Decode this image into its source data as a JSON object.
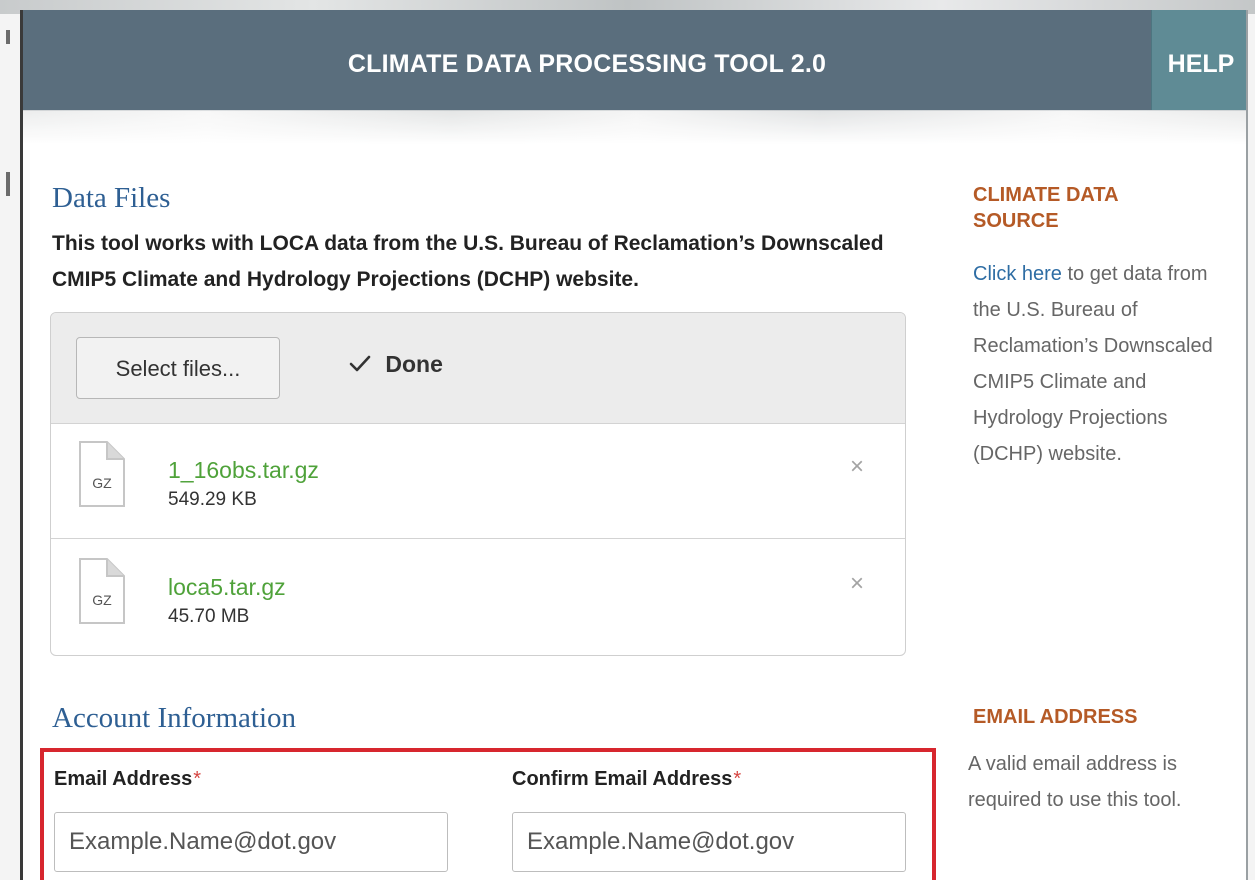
{
  "header": {
    "title": "CLIMATE DATA PROCESSING TOOL 2.0",
    "help_label": "HELP"
  },
  "data_files": {
    "section_title": "Data Files",
    "description": "This tool works with LOCA data from the U.S. Bureau of Reclamation’s Downscaled CMIP5 Climate and Hydrology Projections (DCHP) website.",
    "select_button": "Select files...",
    "status_icon": "check-icon",
    "status_label": "Done",
    "files": [
      {
        "icon_label": "GZ",
        "name": "1_16obs.tar.gz",
        "size": "549.29 KB",
        "remove_icon": "×"
      },
      {
        "icon_label": "GZ",
        "name": "loca5.tar.gz",
        "size": "45.70 MB",
        "remove_icon": "×"
      }
    ]
  },
  "sidebar": {
    "climate_heading": "CLIMATE DATA SOURCE",
    "climate_link": "Click here",
    "climate_text": " to get data from the U.S. Bureau of Reclamation’s Downscaled CMIP5 Climate and Hydrology Projections (DCHP) website.",
    "email_heading": "EMAIL ADDRESS",
    "email_text": "A valid email address is required to use this tool."
  },
  "account": {
    "section_title": "Account Information",
    "required_marker": "*",
    "email_label": "Email Address",
    "email_placeholder": "Example.Name@dot.gov",
    "confirm_label": "Confirm Email Address",
    "confirm_placeholder": "Example.Name@dot.gov"
  },
  "colors": {
    "header_bg": "#5a6e7d",
    "help_bg": "#5f8b95",
    "section_title": "#2e5f93",
    "sidebar_heading": "#b55a26",
    "file_name": "#4fa23a",
    "link": "#2e6da4",
    "highlight_border": "#d7262e"
  }
}
